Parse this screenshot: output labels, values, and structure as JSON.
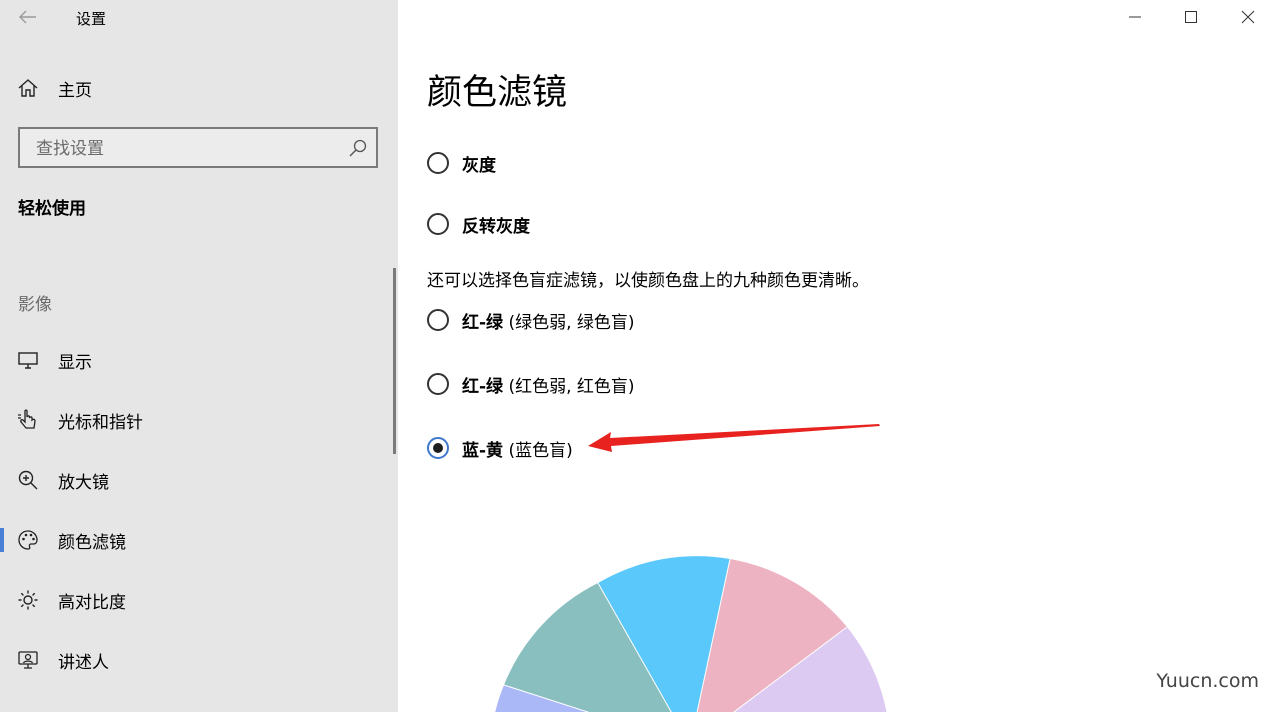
{
  "window": {
    "title": "设置",
    "controls": {
      "minimize": "minimize",
      "maximize": "maximize",
      "close": "close"
    }
  },
  "sidebar": {
    "home_label": "主页",
    "search_placeholder": "查找设置",
    "section_title": "轻松使用",
    "group_label": "影像",
    "items": [
      {
        "label": "显示",
        "icon": "display-icon"
      },
      {
        "label": "光标和指针",
        "icon": "pointer-icon"
      },
      {
        "label": "放大镜",
        "icon": "magnifier-icon"
      },
      {
        "label": "颜色滤镜",
        "icon": "palette-icon",
        "selected": true
      },
      {
        "label": "高对比度",
        "icon": "brightness-icon"
      },
      {
        "label": "讲述人",
        "icon": "narrator-icon"
      }
    ]
  },
  "main": {
    "title": "颜色滤镜",
    "filters": [
      {
        "bold": "灰度",
        "detail": "",
        "checked": false
      },
      {
        "bold": "反转灰度",
        "detail": "",
        "checked": false
      }
    ],
    "description": "还可以选择色盲症滤镜，以使颜色盘上的九种颜色更清晰。",
    "colorblind_filters": [
      {
        "bold": "红-绿",
        "detail": " (绿色弱, 绿色盲)",
        "checked": false
      },
      {
        "bold": "红-绿",
        "detail": " (红色弱, 红色盲)",
        "checked": false
      },
      {
        "bold": "蓝-黄",
        "detail": " (蓝色盲)",
        "checked": true
      }
    ],
    "wheel_colors": [
      "#aab8f8",
      "#8abfbf",
      "#5bc8fb",
      "#edb3c2",
      "#dccaf2"
    ]
  },
  "watermark": "Yuucn.com",
  "accent_color": "#3f78d0",
  "annotation_color": "#e8231f"
}
